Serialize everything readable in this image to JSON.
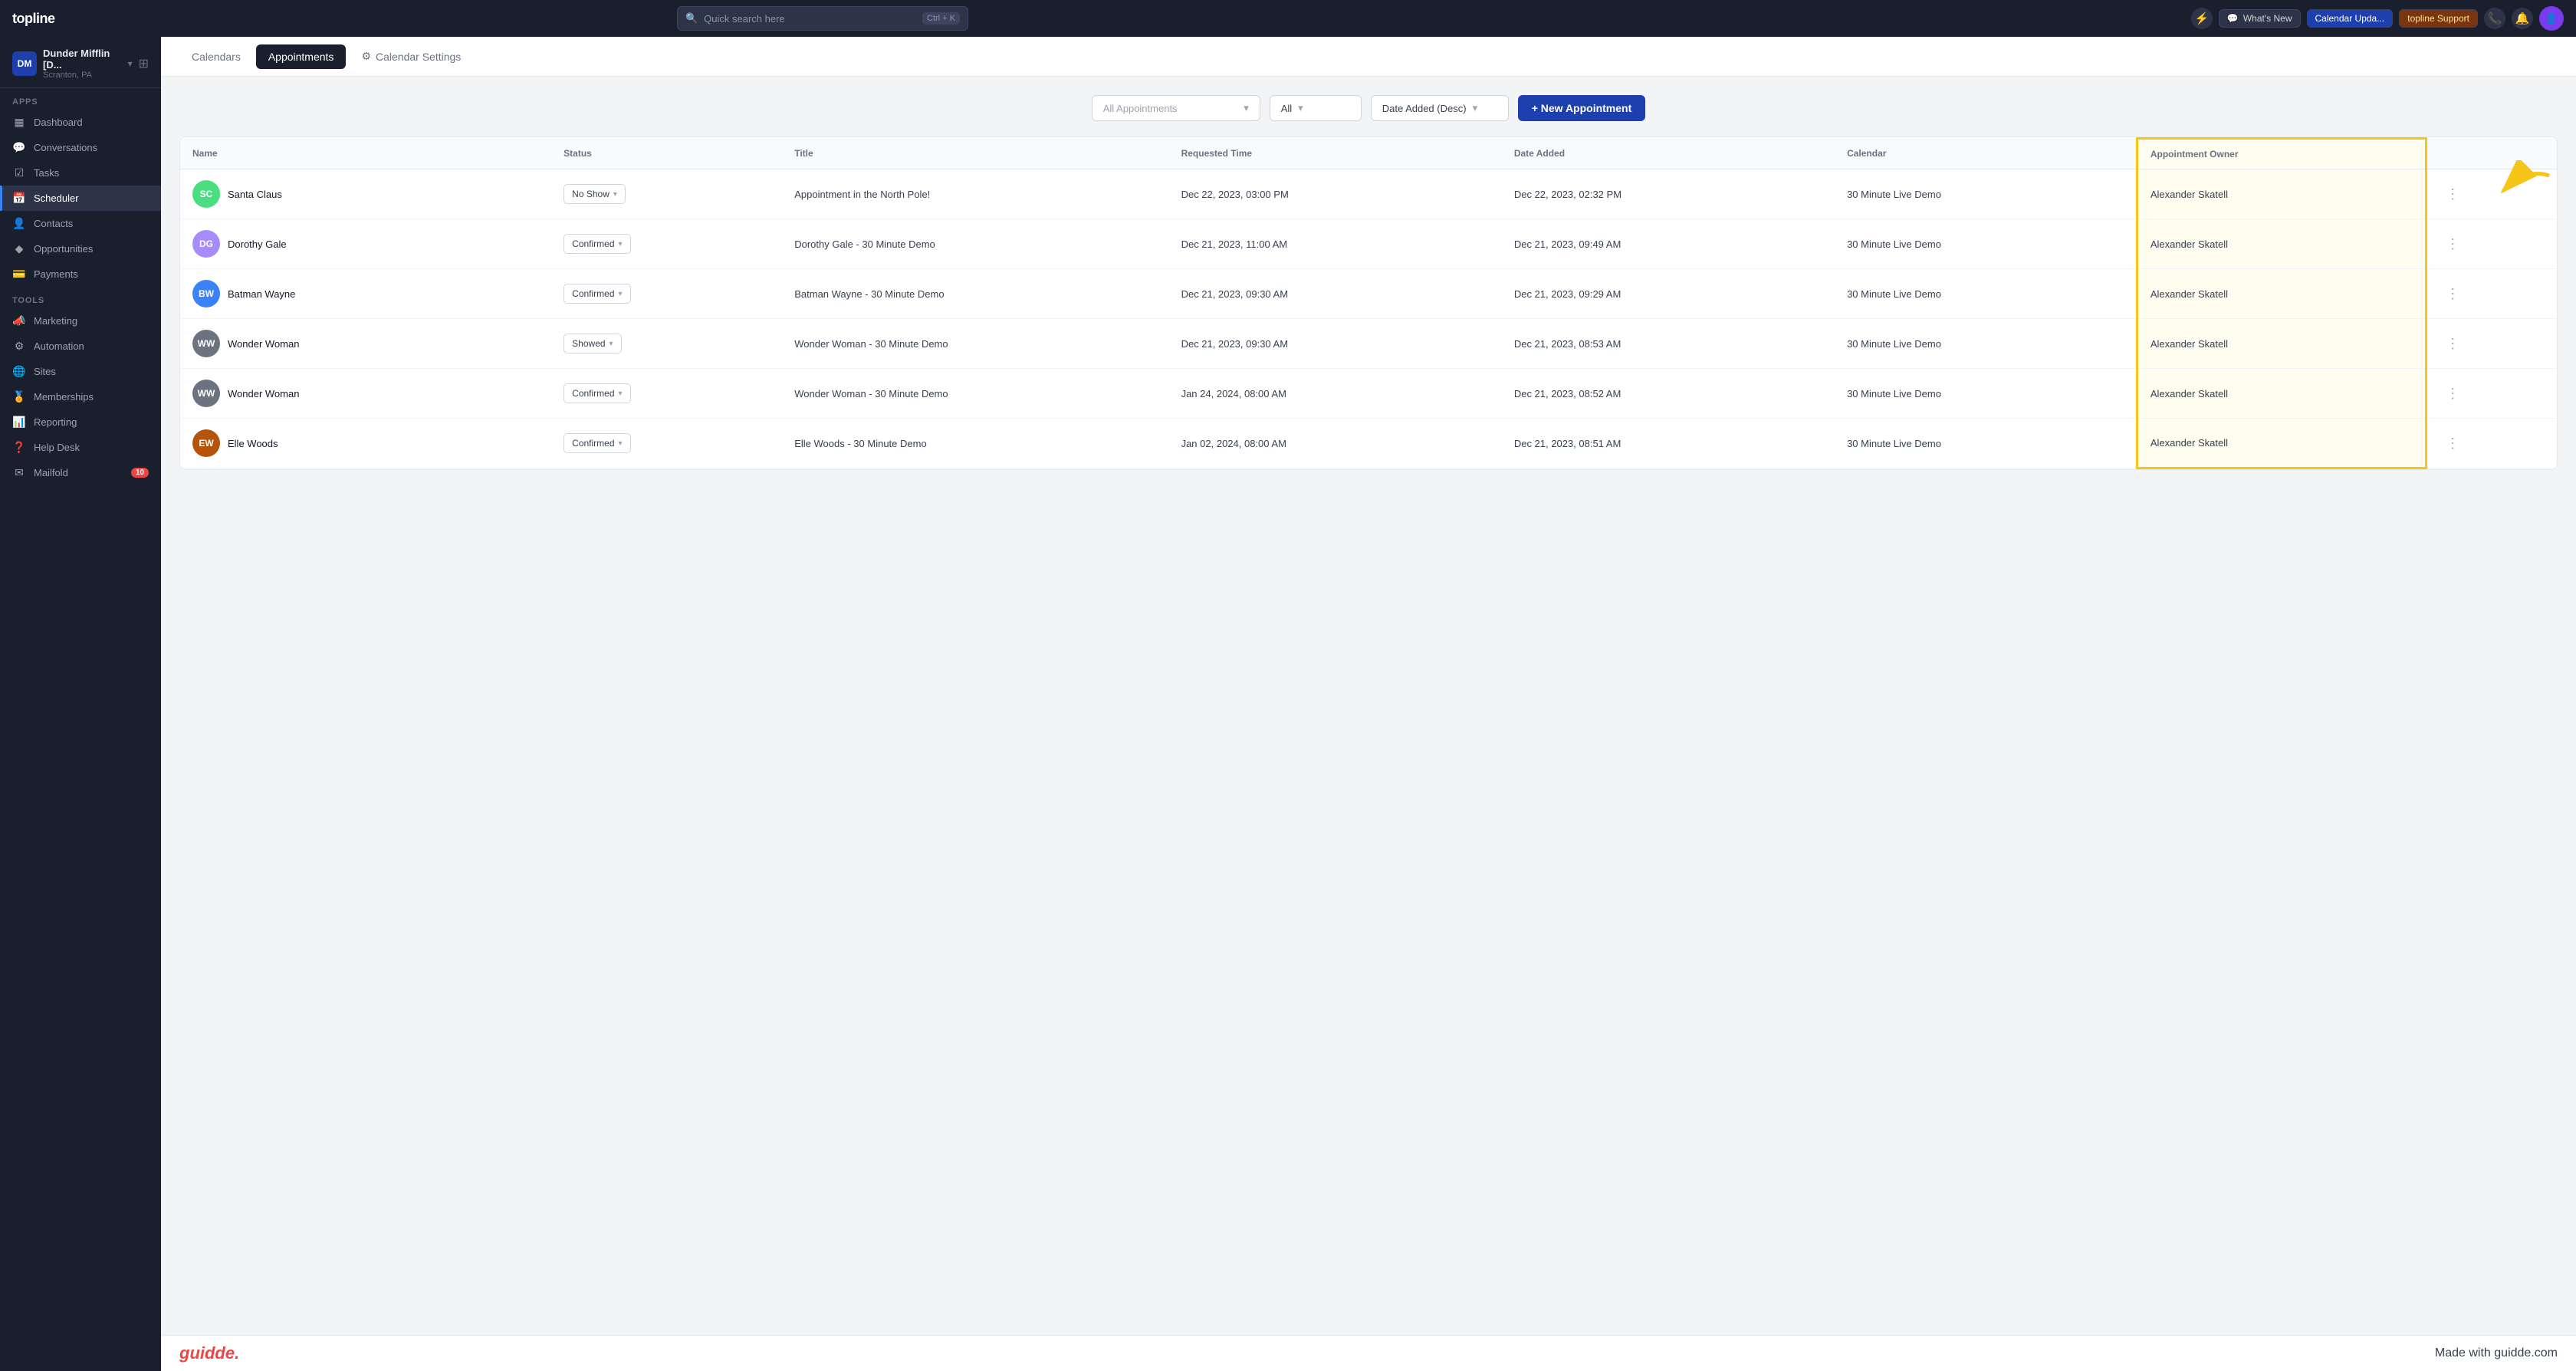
{
  "app": {
    "logo": "topline",
    "search": {
      "placeholder": "Quick search here",
      "shortcut": "Ctrl + K"
    },
    "topnav": {
      "lightning_icon": "⚡",
      "whats_new_label": "What's New",
      "calendar_update_label": "Calendar Upda...",
      "support_label": "topline Support",
      "phone_icon": "📞",
      "bell_icon": "🔔"
    }
  },
  "sidebar": {
    "workspace_name": "Dunder Mifflin [D...",
    "workspace_location": "Scranton, PA",
    "apps_label": "Apps",
    "tools_label": "Tools",
    "items_apps": [
      {
        "id": "dashboard",
        "label": "Dashboard",
        "icon": "▦"
      },
      {
        "id": "conversations",
        "label": "Conversations",
        "icon": "💬"
      },
      {
        "id": "tasks",
        "label": "Tasks",
        "icon": "☑"
      },
      {
        "id": "scheduler",
        "label": "Scheduler",
        "icon": "📅",
        "active": true
      },
      {
        "id": "contacts",
        "label": "Contacts",
        "icon": "👤"
      },
      {
        "id": "opportunities",
        "label": "Opportunities",
        "icon": "◆"
      },
      {
        "id": "payments",
        "label": "Payments",
        "icon": "💳"
      }
    ],
    "items_tools": [
      {
        "id": "marketing",
        "label": "Marketing",
        "icon": "📣"
      },
      {
        "id": "automation",
        "label": "Automation",
        "icon": "⚙"
      },
      {
        "id": "sites",
        "label": "Sites",
        "icon": "🌐"
      },
      {
        "id": "memberships",
        "label": "Memberships",
        "icon": "🏅"
      },
      {
        "id": "reporting",
        "label": "Reporting",
        "icon": "📊"
      },
      {
        "id": "helpdesk",
        "label": "Help Desk",
        "icon": "❓"
      },
      {
        "id": "mailfold",
        "label": "Mailfold",
        "icon": "✉",
        "badge": "10"
      }
    ]
  },
  "subheader": {
    "tabs": [
      {
        "id": "calendars",
        "label": "Calendars"
      },
      {
        "id": "appointments",
        "label": "Appointments",
        "active": true
      },
      {
        "id": "calendar_settings",
        "label": "Calendar Settings",
        "icon": "⚙"
      }
    ]
  },
  "toolbar": {
    "filter_placeholder": "All Appointments",
    "status_filter_value": "All",
    "sort_value": "Date Added (Desc)",
    "new_appointment_label": "+ New Appointment"
  },
  "table": {
    "headers": [
      {
        "id": "name",
        "label": "Name"
      },
      {
        "id": "status",
        "label": "Status"
      },
      {
        "id": "title",
        "label": "Title"
      },
      {
        "id": "requested_time",
        "label": "Requested Time"
      },
      {
        "id": "date_added",
        "label": "Date Added"
      },
      {
        "id": "calendar",
        "label": "Calendar"
      },
      {
        "id": "appt_owner",
        "label": "Appointment Owner",
        "highlighted": true
      }
    ],
    "rows": [
      {
        "id": "row1",
        "name": "Santa Claus",
        "initials": "SC",
        "avatar_color": "#4ade80",
        "status": "No Show",
        "title": "Appointment in the North Pole!",
        "requested_time": "Dec 22, 2023, 03:00 PM",
        "date_added": "Dec 22, 2023, 02:32 PM",
        "calendar": "30 Minute Live Demo",
        "appt_owner": "Alexander Skatell"
      },
      {
        "id": "row2",
        "name": "Dorothy Gale",
        "initials": "DG",
        "avatar_color": "#a78bfa",
        "status": "Confirmed",
        "title": "Dorothy Gale - 30 Minute Demo",
        "requested_time": "Dec 21, 2023, 11:00 AM",
        "date_added": "Dec 21, 2023, 09:49 AM",
        "calendar": "30 Minute Live Demo",
        "appt_owner": "Alexander Skatell"
      },
      {
        "id": "row3",
        "name": "Batman Wayne",
        "initials": "BW",
        "avatar_color": "#3b82f6",
        "status": "Confirmed",
        "title": "Batman Wayne - 30 Minute Demo",
        "requested_time": "Dec 21, 2023, 09:30 AM",
        "date_added": "Dec 21, 2023, 09:29 AM",
        "calendar": "30 Minute Live Demo",
        "appt_owner": "Alexander Skatell"
      },
      {
        "id": "row4",
        "name": "Wonder Woman",
        "initials": "WW",
        "avatar_color": "#6b7280",
        "status": "Showed",
        "title": "Wonder Woman - 30 Minute Demo",
        "requested_time": "Dec 21, 2023, 09:30 AM",
        "date_added": "Dec 21, 2023, 08:53 AM",
        "calendar": "30 Minute Live Demo",
        "appt_owner": "Alexander Skatell"
      },
      {
        "id": "row5",
        "name": "Wonder Woman",
        "initials": "WW",
        "avatar_color": "#6b7280",
        "status": "Confirmed",
        "title": "Wonder Woman - 30 Minute Demo",
        "requested_time": "Jan 24, 2024, 08:00 AM",
        "date_added": "Dec 21, 2023, 08:52 AM",
        "calendar": "30 Minute Live Demo",
        "appt_owner": "Alexander Skatell"
      },
      {
        "id": "row6",
        "name": "Elle Woods",
        "initials": "EW",
        "avatar_color": "#b45309",
        "status": "Confirmed",
        "title": "Elle Woods - 30 Minute Demo",
        "requested_time": "Jan 02, 2024, 08:00 AM",
        "date_added": "Dec 21, 2023, 08:51 AM",
        "calendar": "30 Minute Live Demo",
        "appt_owner": "Alexander Skatell"
      }
    ]
  },
  "footer": {
    "logo": "guidde.",
    "text": "Made with guidde.com"
  }
}
